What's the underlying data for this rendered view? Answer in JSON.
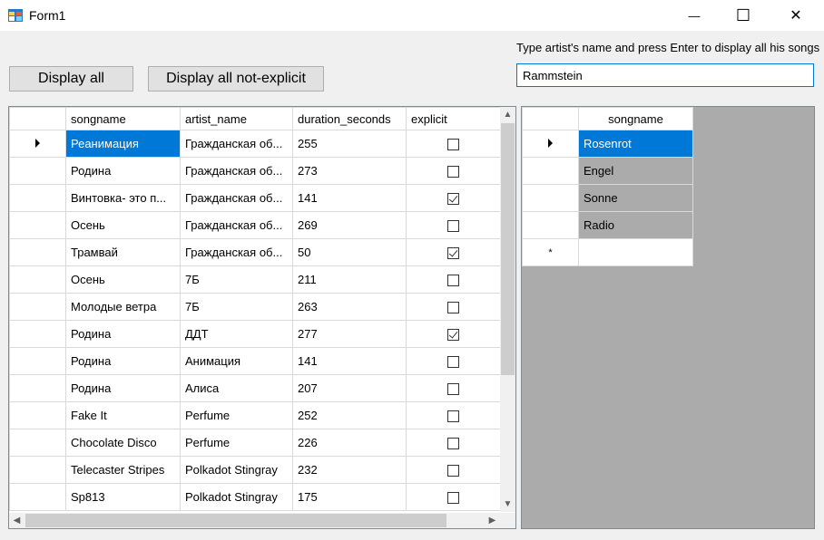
{
  "window": {
    "title": "Form1",
    "minimize": "—",
    "maximize": "☐",
    "close": "✕"
  },
  "buttons": {
    "display_all": "Display all",
    "display_not_explicit": "Display all not-explicit"
  },
  "search": {
    "hint": "Type artist's name and press Enter to display all his songs",
    "value": "Rammstein"
  },
  "songs_grid": {
    "columns": [
      "songname",
      "artist_name",
      "duration_seconds",
      "explicit"
    ],
    "rows": [
      {
        "songname": "Реанимация",
        "artist_name": "Гражданская об...",
        "duration_seconds": "255",
        "explicit": false
      },
      {
        "songname": "Родина",
        "artist_name": "Гражданская об...",
        "duration_seconds": "273",
        "explicit": false
      },
      {
        "songname": "Винтовка- это п...",
        "artist_name": "Гражданская об...",
        "duration_seconds": "141",
        "explicit": true
      },
      {
        "songname": "Осень",
        "artist_name": "Гражданская об...",
        "duration_seconds": "269",
        "explicit": false
      },
      {
        "songname": "Трамвай",
        "artist_name": "Гражданская об...",
        "duration_seconds": "50",
        "explicit": true
      },
      {
        "songname": "Осень",
        "artist_name": "7Б",
        "duration_seconds": "211",
        "explicit": false
      },
      {
        "songname": "Молодые ветра",
        "artist_name": "7Б",
        "duration_seconds": "263",
        "explicit": false
      },
      {
        "songname": "Родина",
        "artist_name": "ДДТ",
        "duration_seconds": "277",
        "explicit": true
      },
      {
        "songname": "Родина",
        "artist_name": "Анимация",
        "duration_seconds": "141",
        "explicit": false
      },
      {
        "songname": "Родина",
        "artist_name": "Алиса",
        "duration_seconds": "207",
        "explicit": false
      },
      {
        "songname": "Fake It",
        "artist_name": "Perfume",
        "duration_seconds": "252",
        "explicit": false
      },
      {
        "songname": "Chocolate Disco",
        "artist_name": "Perfume",
        "duration_seconds": "226",
        "explicit": false
      },
      {
        "songname": "Telecaster Stripes",
        "artist_name": "Polkadot Stingray",
        "duration_seconds": "232",
        "explicit": false
      },
      {
        "songname": "Sp813",
        "artist_name": "Polkadot Stingray",
        "duration_seconds": "175",
        "explicit": false
      }
    ]
  },
  "artist_grid": {
    "columns": [
      "songname"
    ],
    "rows": [
      "Rosenrot",
      "Engel",
      "Sonne",
      "Radio"
    ],
    "new_row_marker": "*"
  },
  "colors": {
    "selection": "#0078d7",
    "grid_background": "#ababab"
  }
}
